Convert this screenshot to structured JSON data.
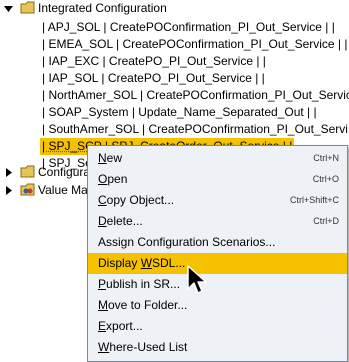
{
  "tree": {
    "root": {
      "label": "Integrated Configuration"
    },
    "leaves": [
      "| APJ_SOL | CreatePOConfirmation_PI_Out_Service | |",
      "| EMEA_SOL | CreatePOConfirmation_PI_Out_Service | |",
      "| IAP_EXC | CreatePO_PI_Out_Service | |",
      "| IAP_SOL | CreatePO_PI_Out_Service | |",
      "| NorthAmer_SOL | CreatePOConfirmation_PI_Out_Service",
      "| SOAP_System | Update_Name_Separated_Out | |",
      "| SouthAmer_SOL | CreatePOConfirmation_PI_Out_Servi",
      "| SPJ_SCP | SPJ_CreateOrder_Out_Service | |",
      "| SPJ_Se"
    ],
    "bottom": [
      {
        "label": "Configura"
      },
      {
        "label": "Value Ma"
      }
    ]
  },
  "context_menu": {
    "items": [
      {
        "pre": "",
        "u": "N",
        "post": "ew",
        "shortcut": "Ctrl+N"
      },
      {
        "pre": "",
        "u": "O",
        "post": "pen",
        "shortcut": "Ctrl+O"
      },
      {
        "pre": "",
        "u": "C",
        "post": "opy Object...",
        "shortcut": "Ctrl+Shift+C"
      },
      {
        "pre": "",
        "u": "D",
        "post": "elete...",
        "shortcut": "Ctrl+D"
      },
      {
        "pre": "Assign Configuration Scenarios...",
        "u": "",
        "post": "",
        "shortcut": ""
      },
      {
        "pre": "Display ",
        "u": "W",
        "post": "SDL...",
        "shortcut": ""
      },
      {
        "pre": "",
        "u": "P",
        "post": "ublish in SR...",
        "shortcut": ""
      },
      {
        "pre": "",
        "u": "M",
        "post": "ove to Folder...",
        "shortcut": ""
      },
      {
        "pre": "",
        "u": "E",
        "post": "xport...",
        "shortcut": ""
      },
      {
        "pre": "",
        "u": "W",
        "post": "here-Used List",
        "shortcut": ""
      }
    ],
    "highlighted_index": 5
  },
  "colors": {
    "selection": "#f6c200",
    "menu_background": "#eef1f5",
    "menu_border": "#7f8a99"
  }
}
